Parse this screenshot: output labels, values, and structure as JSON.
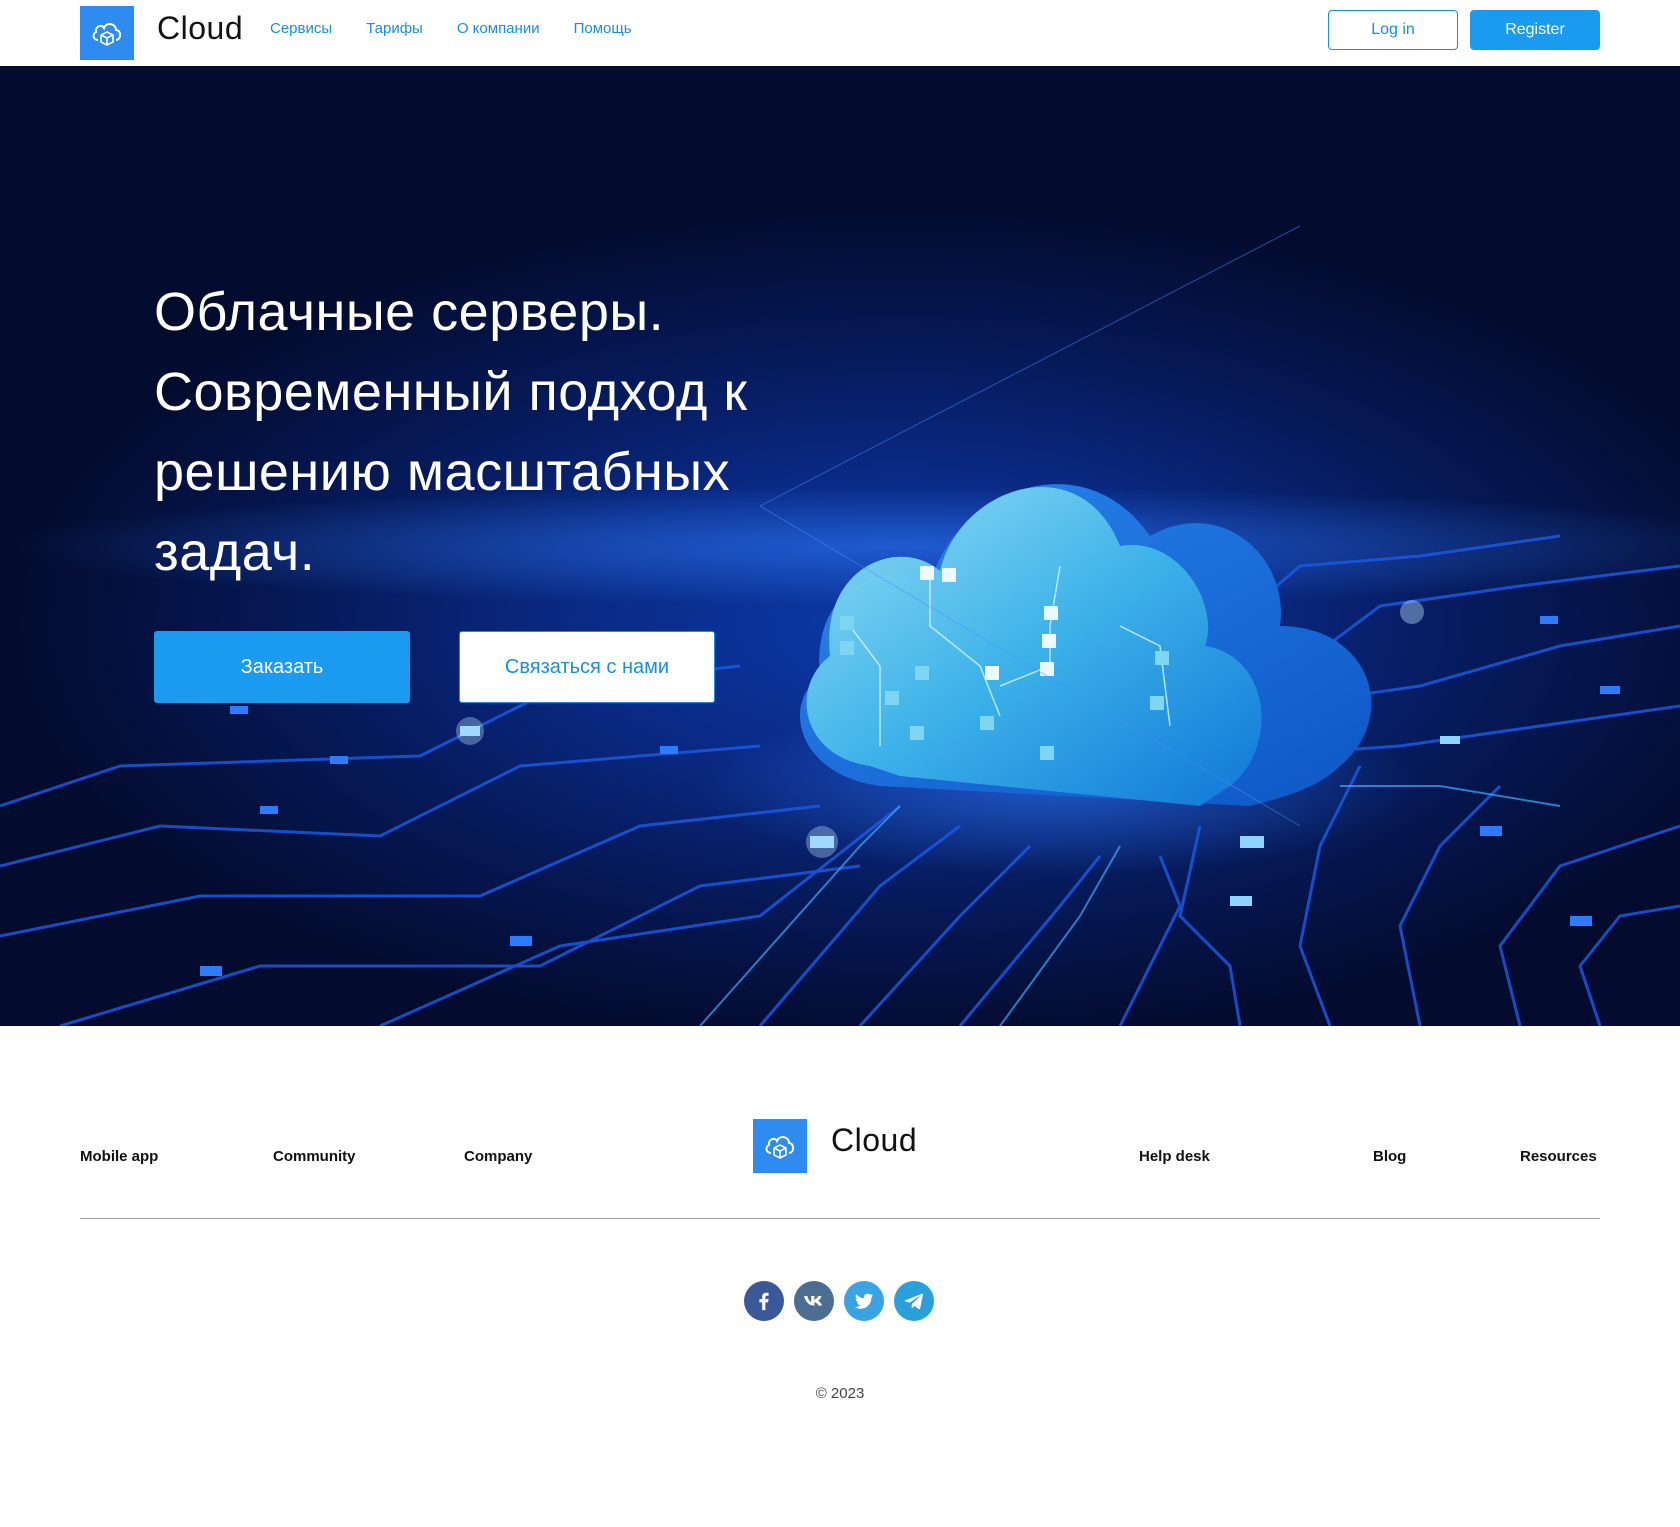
{
  "header": {
    "logo_text": "Cloud",
    "nav": [
      "Сервисы",
      "Тарифы",
      "О компании",
      "Помощь"
    ],
    "login_label": "Log in",
    "register_label": "Register"
  },
  "hero": {
    "title_lines": [
      "Облачные серверы.",
      "Современный подход к",
      "решению масштабных",
      "задач."
    ],
    "order_label": "Заказать",
    "contact_label": "Связаться с нами"
  },
  "footer": {
    "links_left": [
      "Mobile app",
      "Community",
      "Company"
    ],
    "logo_text": "Cloud",
    "links_right": [
      "Help desk",
      "Blog",
      "Resources"
    ],
    "socials": [
      "facebook-icon",
      "vk-icon",
      "twitter-icon",
      "telegram-icon"
    ],
    "copyright": "© 2023"
  },
  "colors": {
    "accent": "#1a9bf0",
    "logo_bg": "#2e8bf0",
    "hero_dark": "#030b2e",
    "facebook": "#3b5998",
    "vk": "#4c6c91",
    "twitter": "#3aa3e3",
    "telegram": "#2aa0db"
  }
}
